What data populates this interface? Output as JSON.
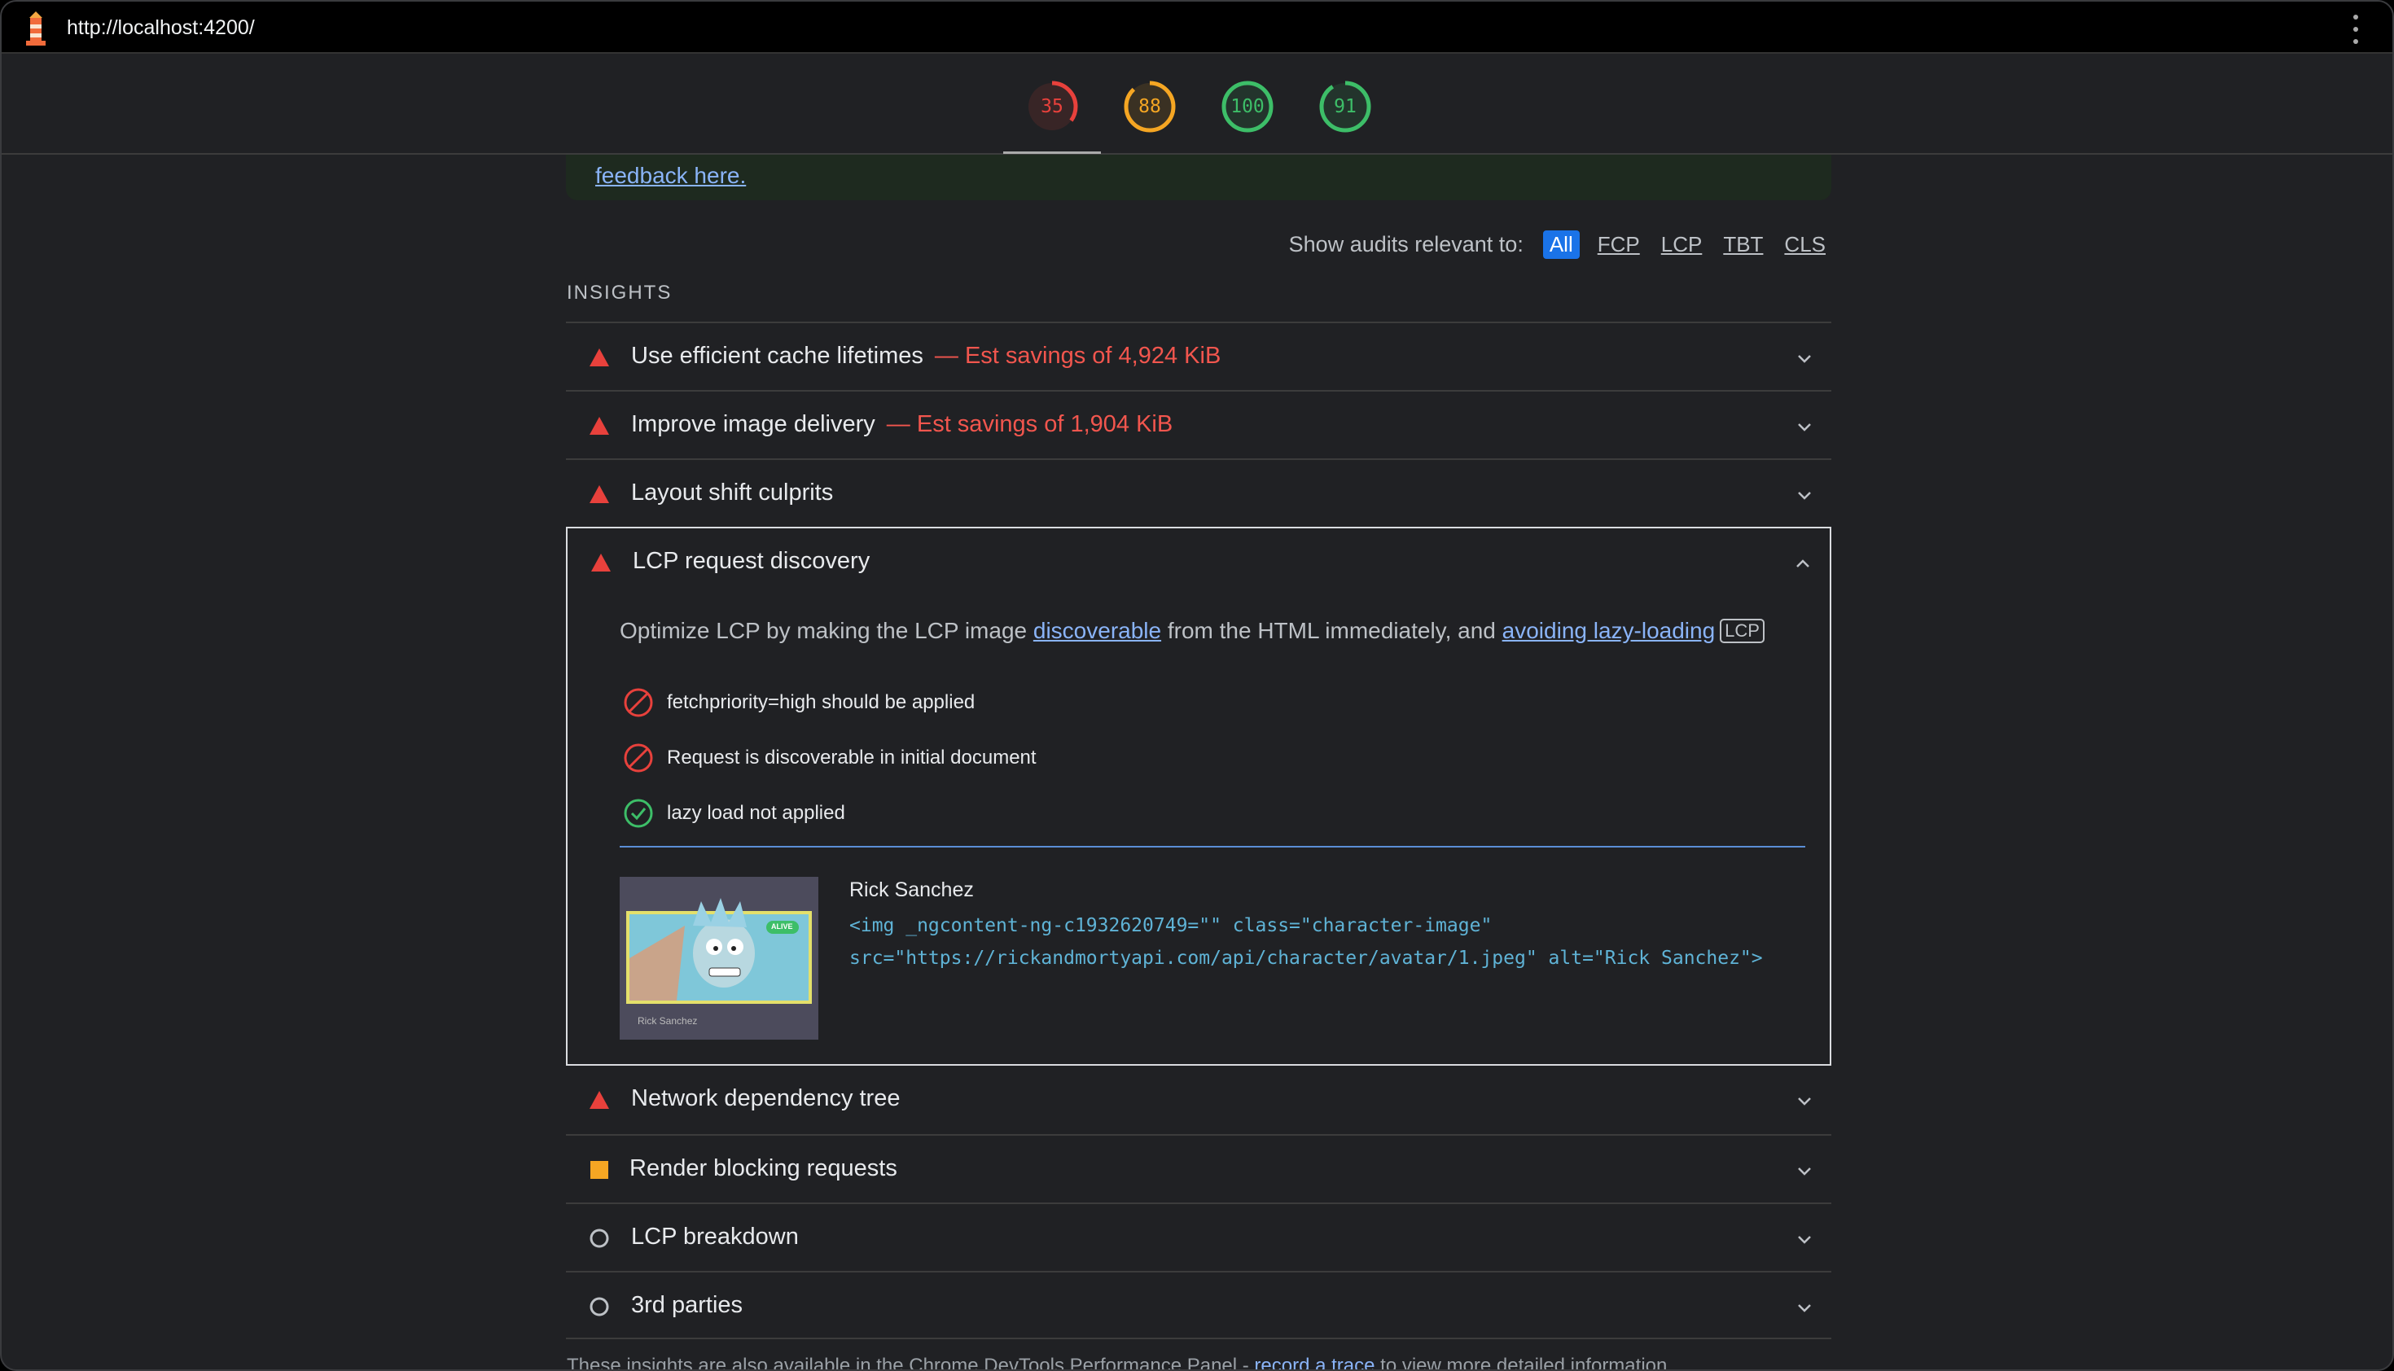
{
  "browser": {
    "url": "http://localhost:4200/",
    "logo_icon": "lighthouse-icon",
    "menu_icon": "more-vertical-icon"
  },
  "scores": [
    {
      "value": "35",
      "color": "#e8413c",
      "fraction": 0.35,
      "category": "performance"
    },
    {
      "value": "88",
      "color": "#f5a623",
      "fraction": 0.88,
      "category": "accessibility"
    },
    {
      "value": "100",
      "color": "#3dbe68",
      "fraction": 1.0,
      "category": "best-practices"
    },
    {
      "value": "91",
      "color": "#3dbe68",
      "fraction": 0.91,
      "category": "seo"
    }
  ],
  "notice": {
    "link_text": "feedback here",
    "trailing": "."
  },
  "filter": {
    "label": "Show audits relevant to:",
    "options": [
      "All",
      "FCP",
      "LCP",
      "TBT",
      "CLS"
    ],
    "selected": "All"
  },
  "insights": {
    "heading": "INSIGHTS",
    "items": [
      {
        "title": "Use efficient cache lifetimes",
        "savings": "— Est savings of 4,924 KiB",
        "status": "fail"
      },
      {
        "title": "Improve image delivery",
        "savings": "— Est savings of 1,904 KiB",
        "status": "fail"
      },
      {
        "title": "Layout shift culprits",
        "savings": "",
        "status": "fail"
      }
    ],
    "expanded": {
      "title": "LCP request discovery",
      "status": "fail",
      "description_pre": "Optimize LCP by making the LCP image ",
      "link1": "discoverable",
      "description_mid": " from the HTML immediately, and ",
      "link2": "avoiding lazy-loading",
      "badge": "LCP",
      "checks": [
        {
          "text": "fetchpriority=high should be applied",
          "state": "fail"
        },
        {
          "text": "Request is discoverable in initial document",
          "state": "fail"
        },
        {
          "text": "lazy load not applied",
          "state": "pass"
        }
      ],
      "node": {
        "label": "Rick Sanchez",
        "code_line1": "<img _ngcontent-ng-c1932620749=\"\" class=\"character-image\"",
        "code_line2": "src=\"https://rickandmortyapi.com/api/character/avatar/1.jpeg\" alt=\"Rick Sanchez\">",
        "thumb_status": "ALIVE",
        "thumb_caption": "Rick Sanchez"
      }
    },
    "items_after": [
      {
        "title": "Network dependency tree",
        "status": "fail"
      },
      {
        "title": "Render blocking requests",
        "status": "average"
      },
      {
        "title": "LCP breakdown",
        "status": "info"
      },
      {
        "title": "3rd parties",
        "status": "info"
      }
    ]
  },
  "footer": {
    "pre": "These insights are also available in the Chrome DevTools Performance Panel - ",
    "link": "record a trace",
    "post": " to view more detailed information."
  },
  "colors": {
    "fail": "#e8413c",
    "average": "#f5a623",
    "pass": "#3dbe68",
    "link": "#8ab4f8"
  }
}
